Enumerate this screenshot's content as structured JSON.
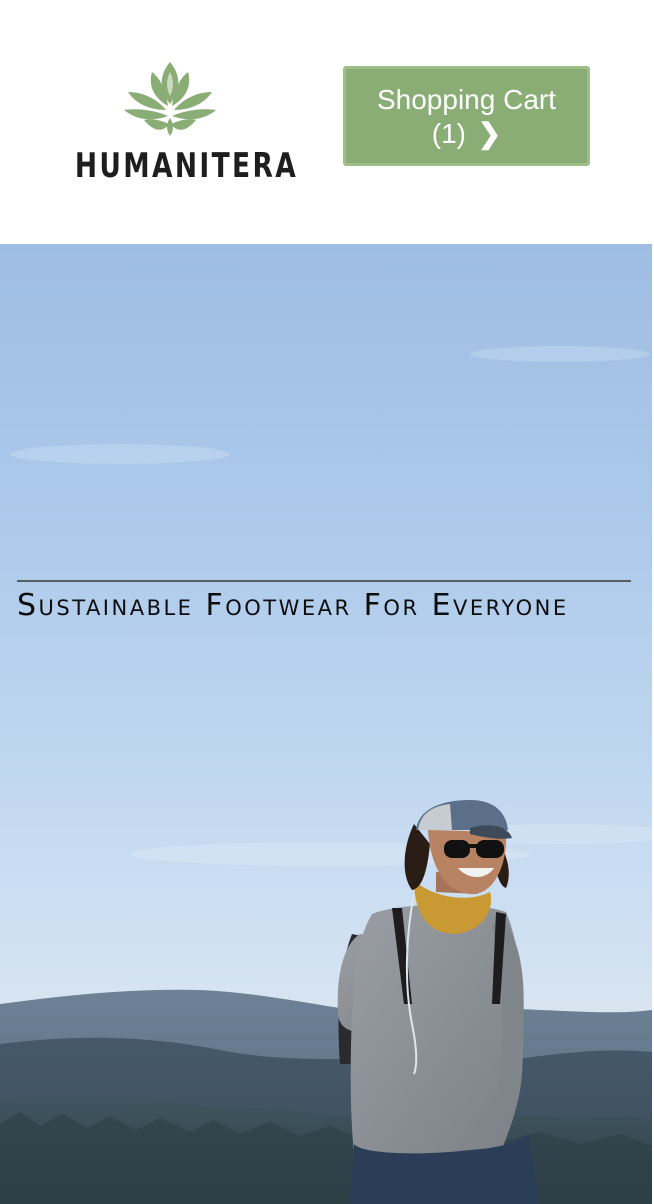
{
  "header": {
    "logo_text": "HUMANITERA",
    "cart_button": {
      "label": "Shopping Cart",
      "count": "(1)",
      "chevron": "❯"
    }
  },
  "hero": {
    "tagline": "Sustainable Footwear For Everyone",
    "image_subject": "hiker-on-mountain-ridge"
  },
  "colors": {
    "brand_green": "#8aad75",
    "sky": "#aac8ea",
    "text_dark": "#1e1e1e"
  }
}
